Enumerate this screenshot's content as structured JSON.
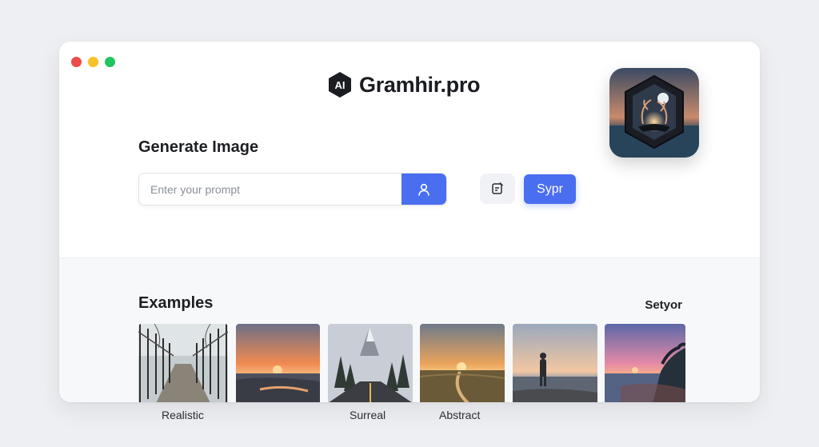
{
  "window": {
    "controls": [
      "close",
      "minimize",
      "maximize"
    ]
  },
  "brand": {
    "logo_text": "AI",
    "name": "Gramhir.pro"
  },
  "generator": {
    "title": "Generate Image",
    "prompt_placeholder": "Enter your prompt",
    "prompt_value": "",
    "submit_icon": "user-icon",
    "tool_icon": "document-edit-icon",
    "primary_label": "Sypr"
  },
  "examples": {
    "title": "Examples",
    "link_label": "Setyor",
    "items": [
      {
        "name": "fence-path",
        "caption": "Realistic"
      },
      {
        "name": "orange-sunset",
        "caption": ""
      },
      {
        "name": "snowy-road",
        "caption": "Surreal"
      },
      {
        "name": "field-sunset",
        "caption": "Abstract"
      },
      {
        "name": "person-shore",
        "caption": ""
      },
      {
        "name": "pink-coast",
        "caption": ""
      }
    ]
  },
  "colors": {
    "accent": "#4a6ef0",
    "background": "#eeeff2",
    "window": "#ffffff",
    "lower_panel": "#f7f8f9"
  }
}
